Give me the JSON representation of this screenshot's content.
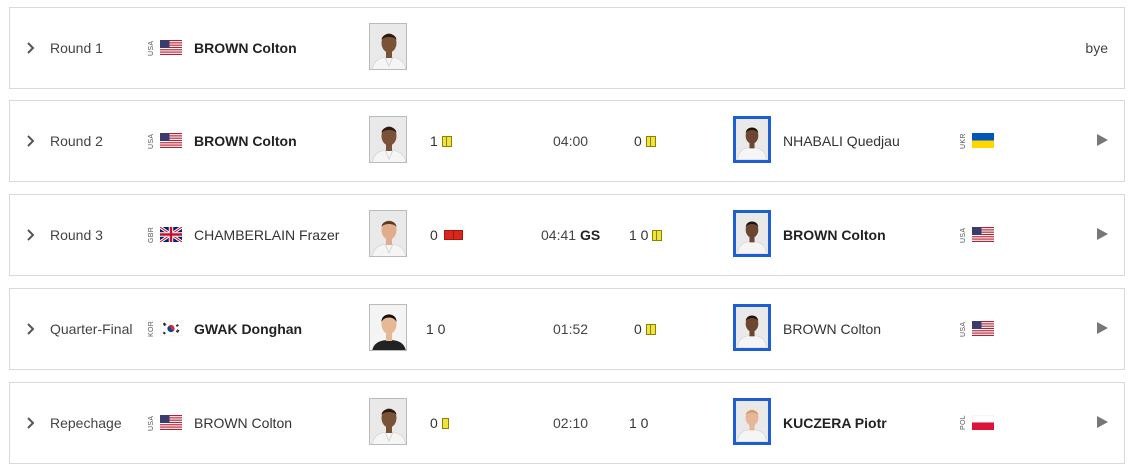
{
  "colors": {
    "border": "#d9d9d9",
    "penalty_yellow": "#f1e33b",
    "penalty_red": "#d9251c",
    "blue_judogi": "#1d5fd0"
  },
  "rows": [
    {
      "round": "Round 1",
      "left": {
        "country": "USA",
        "name": "BROWN Colton"
      },
      "bye": "bye"
    },
    {
      "round": "Round 2",
      "left": {
        "country": "USA",
        "name": "BROWN Colton",
        "score": "1"
      },
      "time": "04:00",
      "right": {
        "score": "0",
        "name": "NHABALI Quedjau",
        "country": "UKR"
      }
    },
    {
      "round": "Round 3",
      "left": {
        "country": "GBR",
        "name": "CHAMBERLAIN Frazer",
        "score": "0"
      },
      "time": "04:41",
      "golden_score": "GS",
      "right": {
        "score": "1 0",
        "name": "BROWN Colton",
        "country": "USA"
      }
    },
    {
      "round": "Quarter-Final",
      "left": {
        "country": "KOR",
        "name": "GWAK Donghan",
        "score": "1 0"
      },
      "time": "01:52",
      "right": {
        "score": "0",
        "name": "BROWN Colton",
        "country": "USA"
      }
    },
    {
      "round": "Repechage",
      "left": {
        "country": "USA",
        "name": "BROWN Colton",
        "score": "0"
      },
      "time": "02:10",
      "right": {
        "score": "1 0",
        "name": "KUCZERA Piotr",
        "country": "POL"
      }
    }
  ]
}
